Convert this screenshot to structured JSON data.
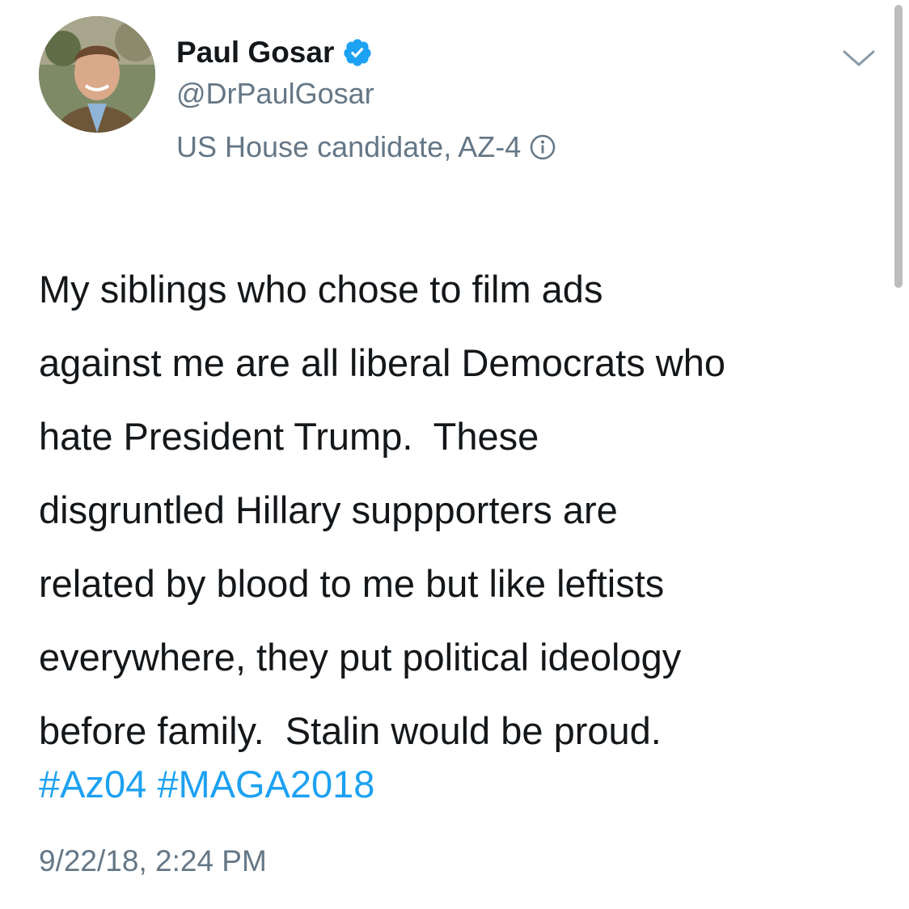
{
  "author": {
    "name": "Paul Gosar",
    "handle": "@DrPaulGosar",
    "label": "US House candidate, AZ-4",
    "verified": true
  },
  "icons": {
    "verified": "verified-badge-icon",
    "info": "info-icon",
    "menu": "chevron-down-icon",
    "avatar": "profile-photo"
  },
  "tweet": {
    "lines": [
      "My siblings who chose to film ads",
      "against me are all liberal Democrats who",
      "hate President Trump.  These",
      "disgruntled Hillary suppporters are",
      "related by blood to me but like leftists",
      "everywhere, they put political ideology",
      "before family.  Stalin would be proud."
    ],
    "hashtags": [
      "#Az04",
      "#MAGA2018"
    ]
  },
  "timestamp": "9/22/18, 2:24 PM",
  "colors": {
    "text": "#14171a",
    "secondary": "#657786",
    "link": "#1da1f2",
    "verified": "#1da1f2"
  }
}
